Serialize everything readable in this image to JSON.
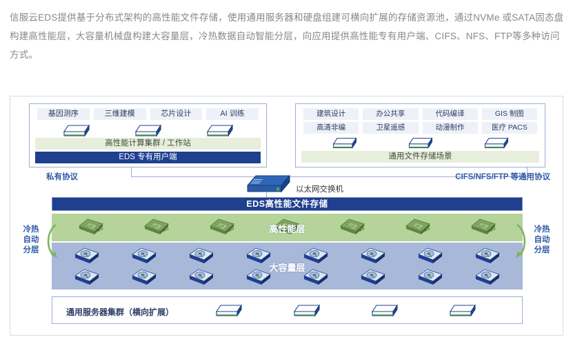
{
  "intro": {
    "paragraph": "信服云EDS提供基于分布式架构的高性能文件存储，使用通用服务器和硬盘组建可横向扩展的存储资源池，通过NVMe 或SATA固态盘构建高性能层，大容量机械盘构建大容量层，冷热数据自动智能分层，向应用提供高性能专有用户端、CIFS、NFS、FTP等多种访问方式。"
  },
  "diagram": {
    "left_panel": {
      "tags": [
        "基因测序",
        "三维建模",
        "芯片设计",
        "AI 训练"
      ],
      "server_count": 3,
      "green_band": "高性能计算集群 / 工作站",
      "navy_band": "EDS 专有用户端"
    },
    "right_panel": {
      "tags_row1": [
        "建筑设计",
        "办公共享",
        "代码编译",
        "GIS 制图"
      ],
      "tags_row2": [
        "高清非编",
        "卫星遥感",
        "动漫制作",
        "医疗 PACS"
      ],
      "server_count": 3,
      "green_band": "通用文件存储场景"
    },
    "protocol_left": "私有协议",
    "protocol_right": "CIFS/NFS/FTP 等通用协议",
    "switch_label": "以太网交换机",
    "storage_bar": "EDS高性能文件存储",
    "performance_tier": {
      "name": "高性能层",
      "disk_label": "SSD",
      "disk_count": 7
    },
    "capacity_tier": {
      "name": "大容量层",
      "disk_count_per_row": 8,
      "rows": 2
    },
    "tiering_left": "冷热\n自动\n分层",
    "tiering_left_lines": [
      "冷热",
      "自动",
      "分层"
    ],
    "tiering_right_lines": [
      "冷热",
      "自动",
      "分层"
    ],
    "cluster": {
      "label": "通用服务器集群（横向扩展）",
      "server_count": 4
    }
  },
  "colors": {
    "navy": "#1f3f8f",
    "tier_green": "#b5d39a",
    "tier_blue": "#a8b8d8",
    "band_green": "#e8eedc",
    "tag_bg": "#eef1f7",
    "accent_blue": "#2f5aa8",
    "border_blue": "#9badd4",
    "intro_text": "#888888"
  }
}
